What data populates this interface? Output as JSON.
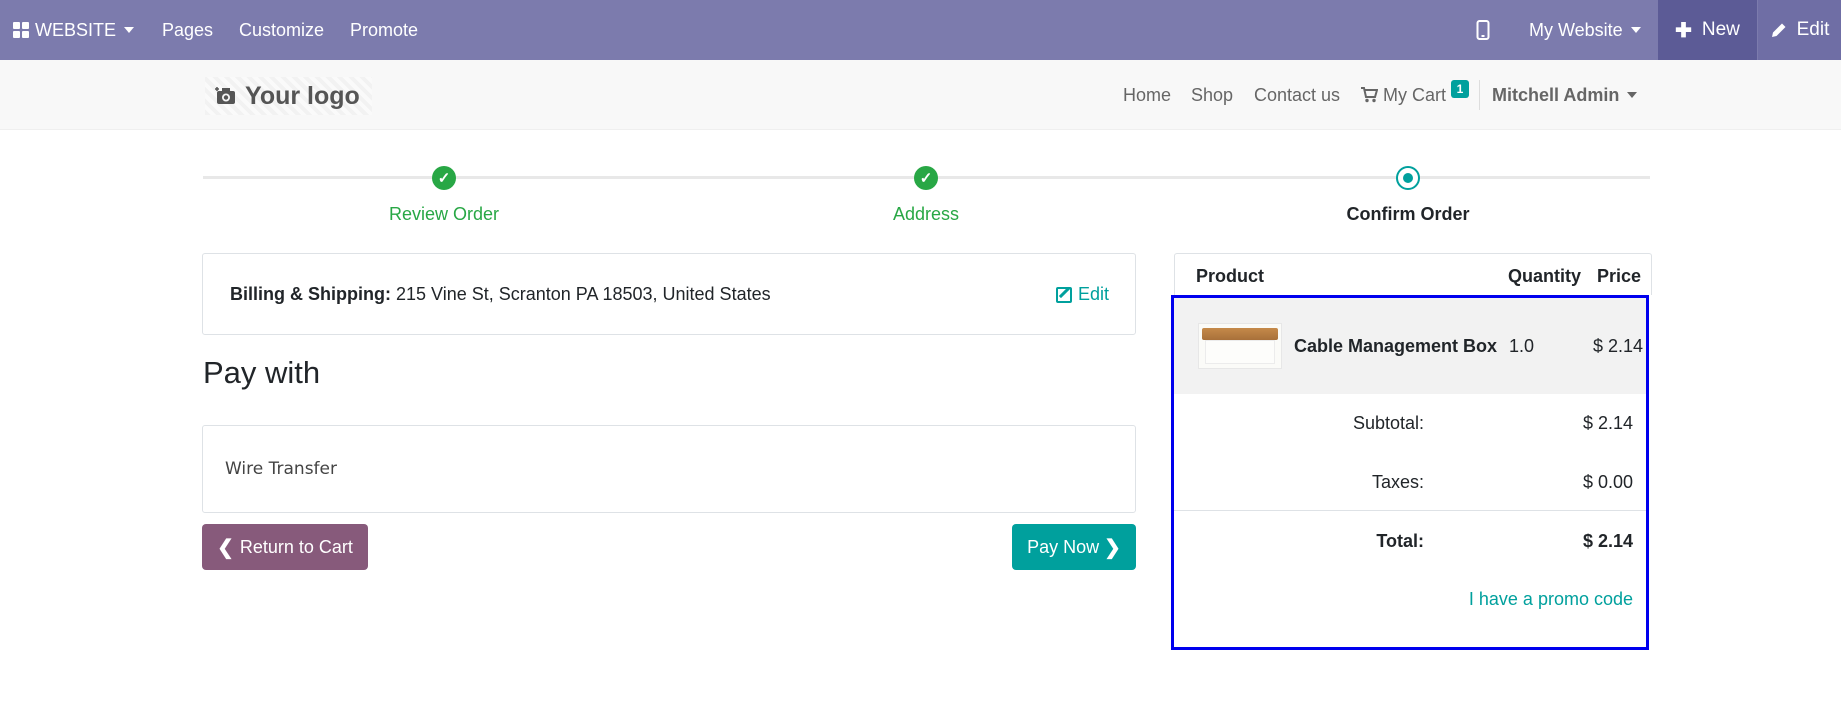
{
  "admin_bar": {
    "website_label": "WEBSITE",
    "menu": [
      "Pages",
      "Customize",
      "Promote"
    ],
    "site_selector": "My Website",
    "new_label": "New",
    "edit_label": "Edit",
    "bg_color": "#7c7bad"
  },
  "header": {
    "logo_text": "Your logo",
    "nav": [
      "Home",
      "Shop",
      "Contact us"
    ],
    "cart_label": "My Cart",
    "cart_count": "1",
    "user": "Mitchell Admin"
  },
  "steps": [
    {
      "label": "Review Order",
      "state": "done"
    },
    {
      "label": "Address",
      "state": "done"
    },
    {
      "label": "Confirm Order",
      "state": "current"
    }
  ],
  "billing": {
    "label": "Billing & Shipping:",
    "address": "215 Vine St, Scranton PA 18503, United States",
    "edit_label": "Edit"
  },
  "payment": {
    "title": "Pay with",
    "method": "Wire Transfer",
    "return_label": "Return to Cart",
    "pay_label": "Pay Now"
  },
  "summary": {
    "headers": {
      "product": "Product",
      "quantity": "Quantity",
      "price": "Price"
    },
    "items": [
      {
        "name": "Cable Management Box",
        "quantity": "1.0",
        "price": "$ 2.14"
      }
    ],
    "subtotal_label": "Subtotal:",
    "subtotal": "$ 2.14",
    "taxes_label": "Taxes:",
    "taxes": "$ 0.00",
    "total_label": "Total:",
    "total": "$ 2.14",
    "promo_label": "I have a promo code",
    "highlight_color": "#0000ee"
  },
  "colors": {
    "accent": "#00a09d",
    "success": "#28a745",
    "secondary": "#875a7b"
  }
}
